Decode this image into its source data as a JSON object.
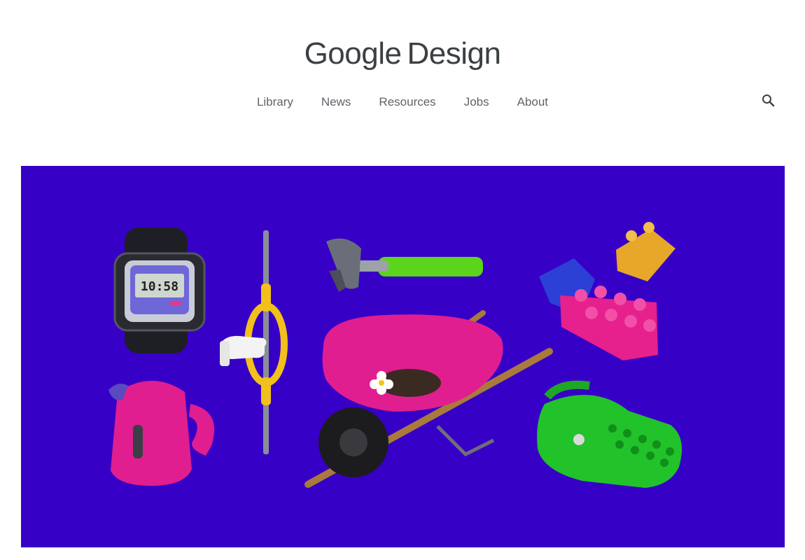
{
  "header": {
    "logo_brand": "Google",
    "logo_sub": "Design",
    "nav": [
      {
        "label": "Library"
      },
      {
        "label": "News"
      },
      {
        "label": "Resources"
      },
      {
        "label": "Jobs"
      },
      {
        "label": "About"
      }
    ],
    "search_icon": "search-icon"
  },
  "hero": {
    "background": "#3700c6",
    "watch_time": "10:58"
  }
}
